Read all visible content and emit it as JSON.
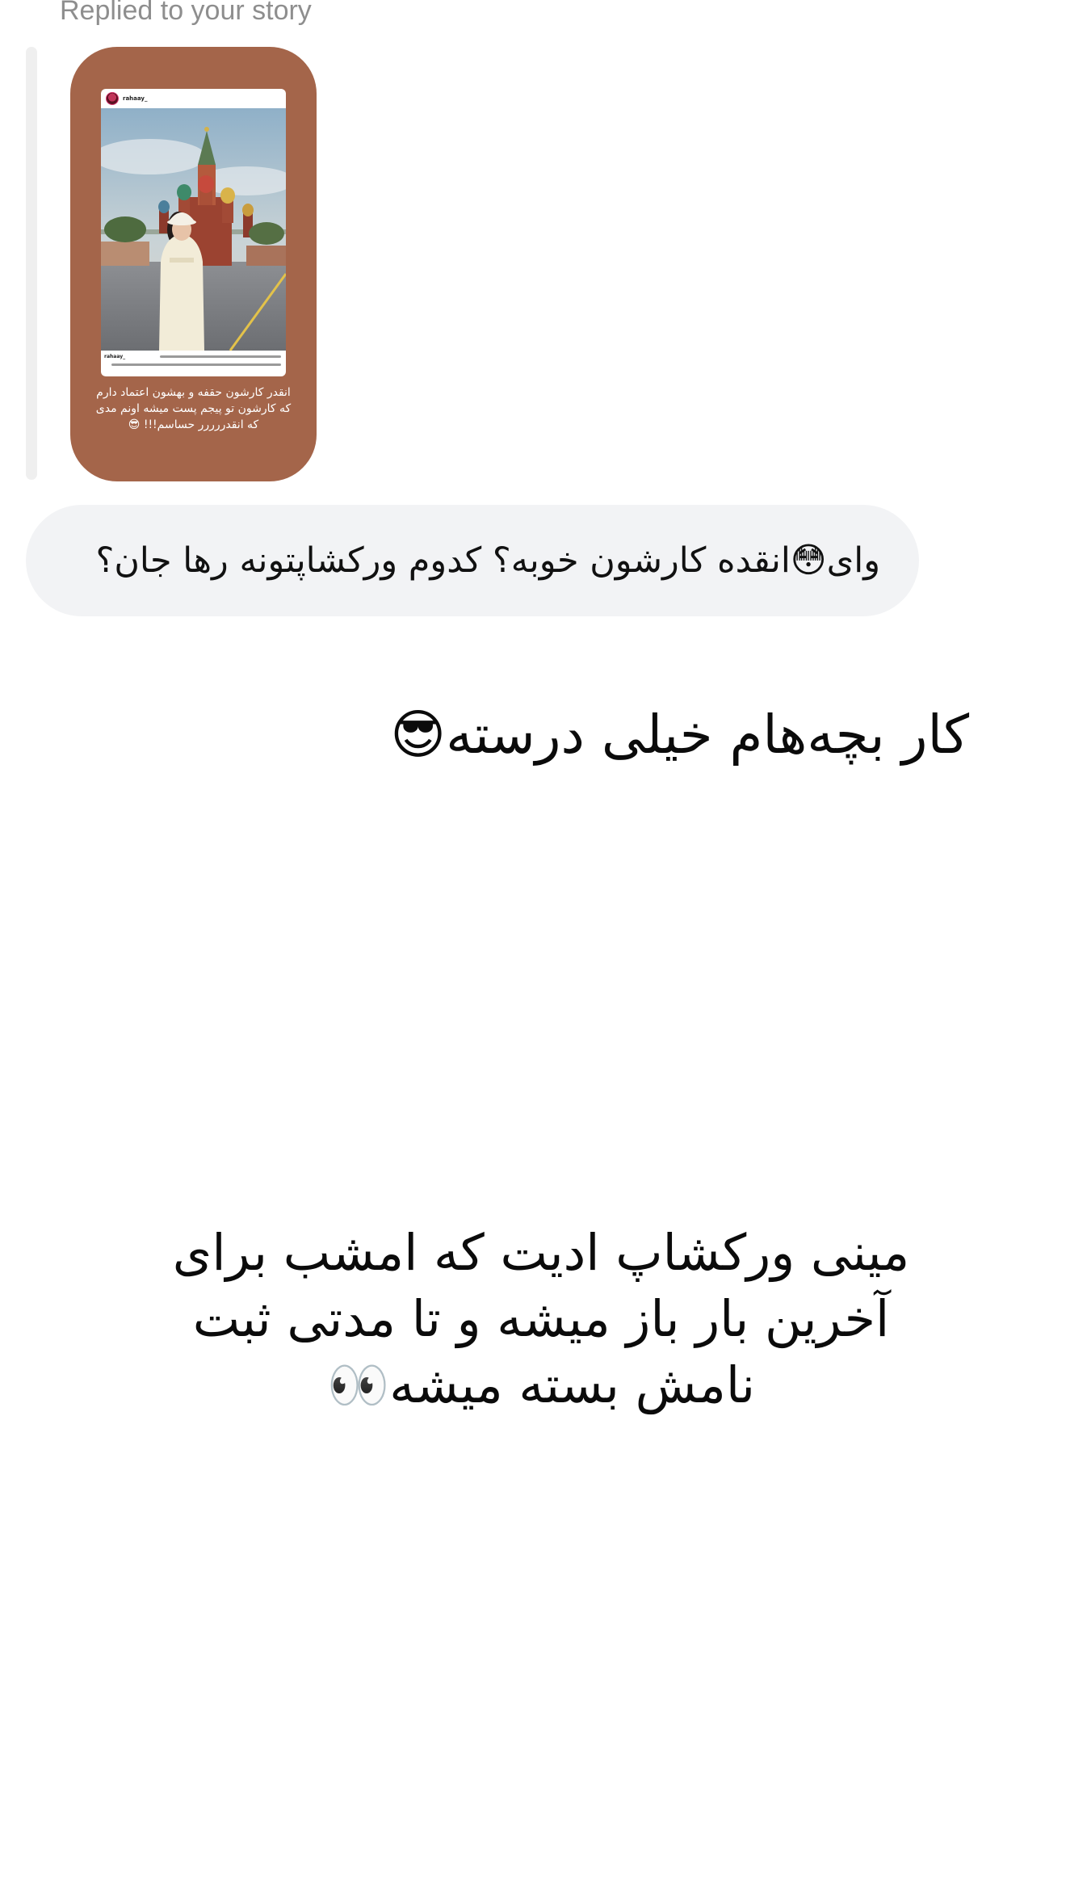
{
  "thread": {
    "replied_label": "Replied to your story",
    "story": {
      "username": "rahaay_",
      "caption_user": "rahaay_",
      "text": "انقدر کارشون حقفه و بهشون اعتماد دارم که کارشون تو پیجم پست میشه اونم مدی که انقدررررر حساسم!!! 😎",
      "background_color": "#a4654a"
    },
    "incoming_message": "وای😳انقده کارشون خوبه؟ کدوم ورکشاپتونه رها جان؟",
    "outgoing_messages": [
      "کار بچه‌هام خیلی درسته😎",
      "مینی ورکشاپ ادیت که امشب برای آخرین بار باز میشه و تا مدتی ثبت نامش بسته میشه👀"
    ]
  }
}
